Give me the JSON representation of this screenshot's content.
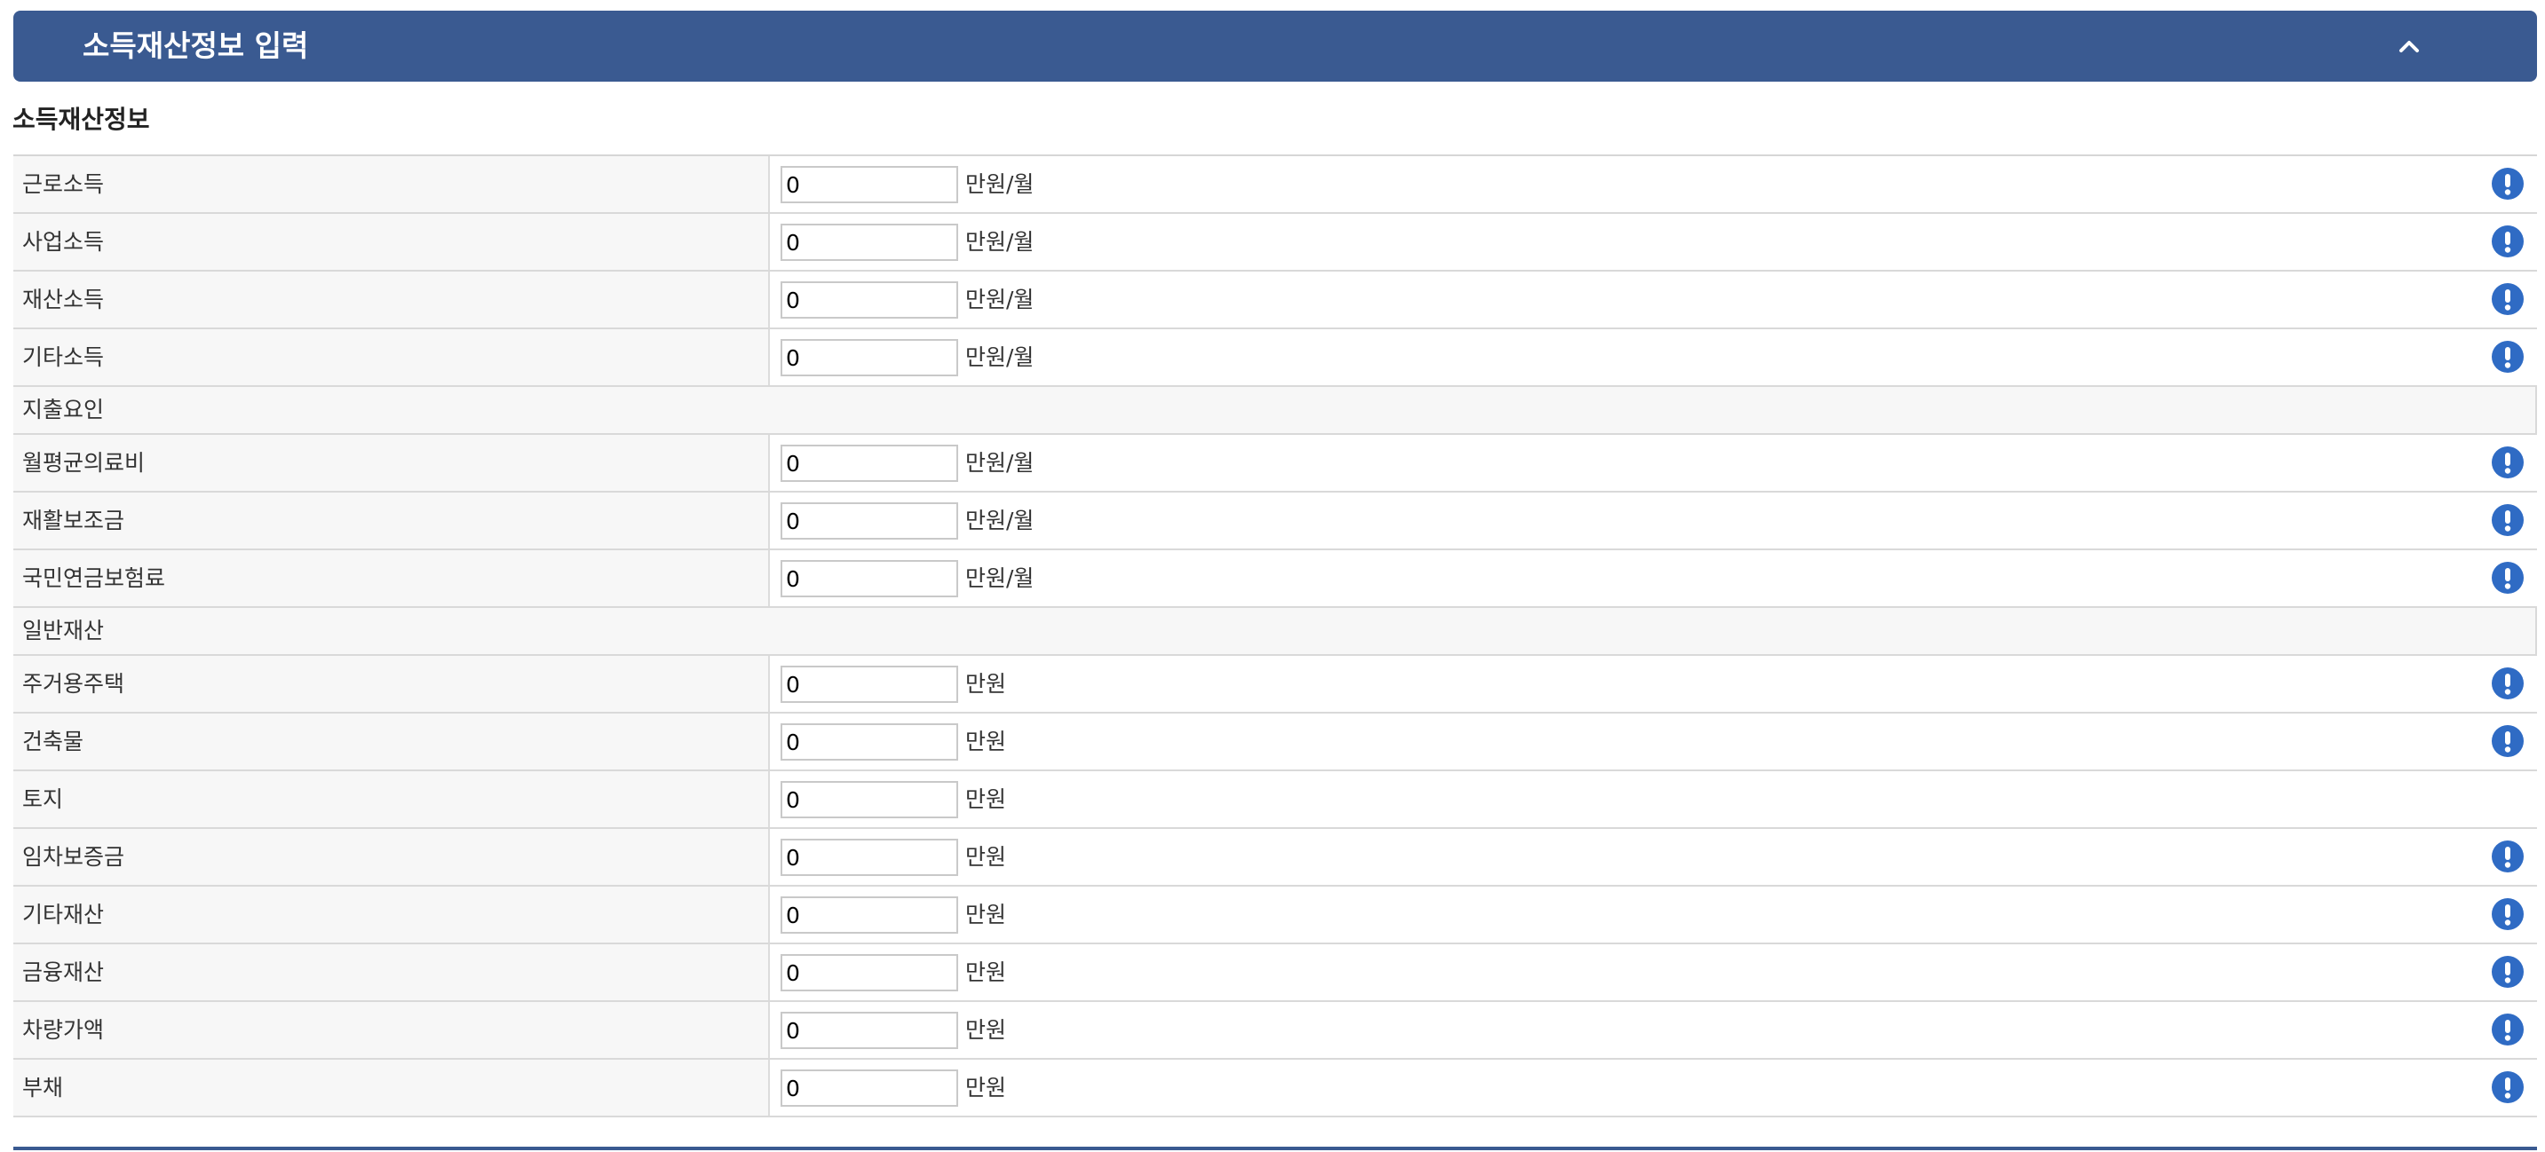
{
  "header": {
    "title": "소득재산정보 입력"
  },
  "section": {
    "title": "소득재산정보"
  },
  "rows": [
    {
      "type": "field",
      "label": "근로소득",
      "value": "0",
      "unit": "만원/월",
      "info": true
    },
    {
      "type": "field",
      "label": "사업소득",
      "value": "0",
      "unit": "만원/월",
      "info": true
    },
    {
      "type": "field",
      "label": "재산소득",
      "value": "0",
      "unit": "만원/월",
      "info": true
    },
    {
      "type": "field",
      "label": "기타소득",
      "value": "0",
      "unit": "만원/월",
      "info": true
    },
    {
      "type": "group",
      "label": "지출요인"
    },
    {
      "type": "field",
      "label": "월평균의료비",
      "value": "0",
      "unit": "만원/월",
      "info": true
    },
    {
      "type": "field",
      "label": "재활보조금",
      "value": "0",
      "unit": "만원/월",
      "info": true
    },
    {
      "type": "field",
      "label": "국민연금보험료",
      "value": "0",
      "unit": "만원/월",
      "info": true
    },
    {
      "type": "group",
      "label": "일반재산"
    },
    {
      "type": "field",
      "label": "주거용주택",
      "value": "0",
      "unit": "만원",
      "info": true
    },
    {
      "type": "field",
      "label": "건축물",
      "value": "0",
      "unit": "만원",
      "info": true
    },
    {
      "type": "field",
      "label": "토지",
      "value": "0",
      "unit": "만원",
      "info": false
    },
    {
      "type": "field",
      "label": "임차보증금",
      "value": "0",
      "unit": "만원",
      "info": true
    },
    {
      "type": "field",
      "label": "기타재산",
      "value": "0",
      "unit": "만원",
      "info": true
    },
    {
      "type": "field",
      "label": "금융재산",
      "value": "0",
      "unit": "만원",
      "info": true
    },
    {
      "type": "field",
      "label": "차량가액",
      "value": "0",
      "unit": "만원",
      "info": true
    },
    {
      "type": "field",
      "label": "부채",
      "value": "0",
      "unit": "만원",
      "info": true
    }
  ],
  "icons": {
    "collapse": "chevron-up-icon",
    "info": "exclamation-circle-icon"
  },
  "colors": {
    "header_bg": "#3a5a91",
    "info_icon": "#2f6bc4"
  }
}
